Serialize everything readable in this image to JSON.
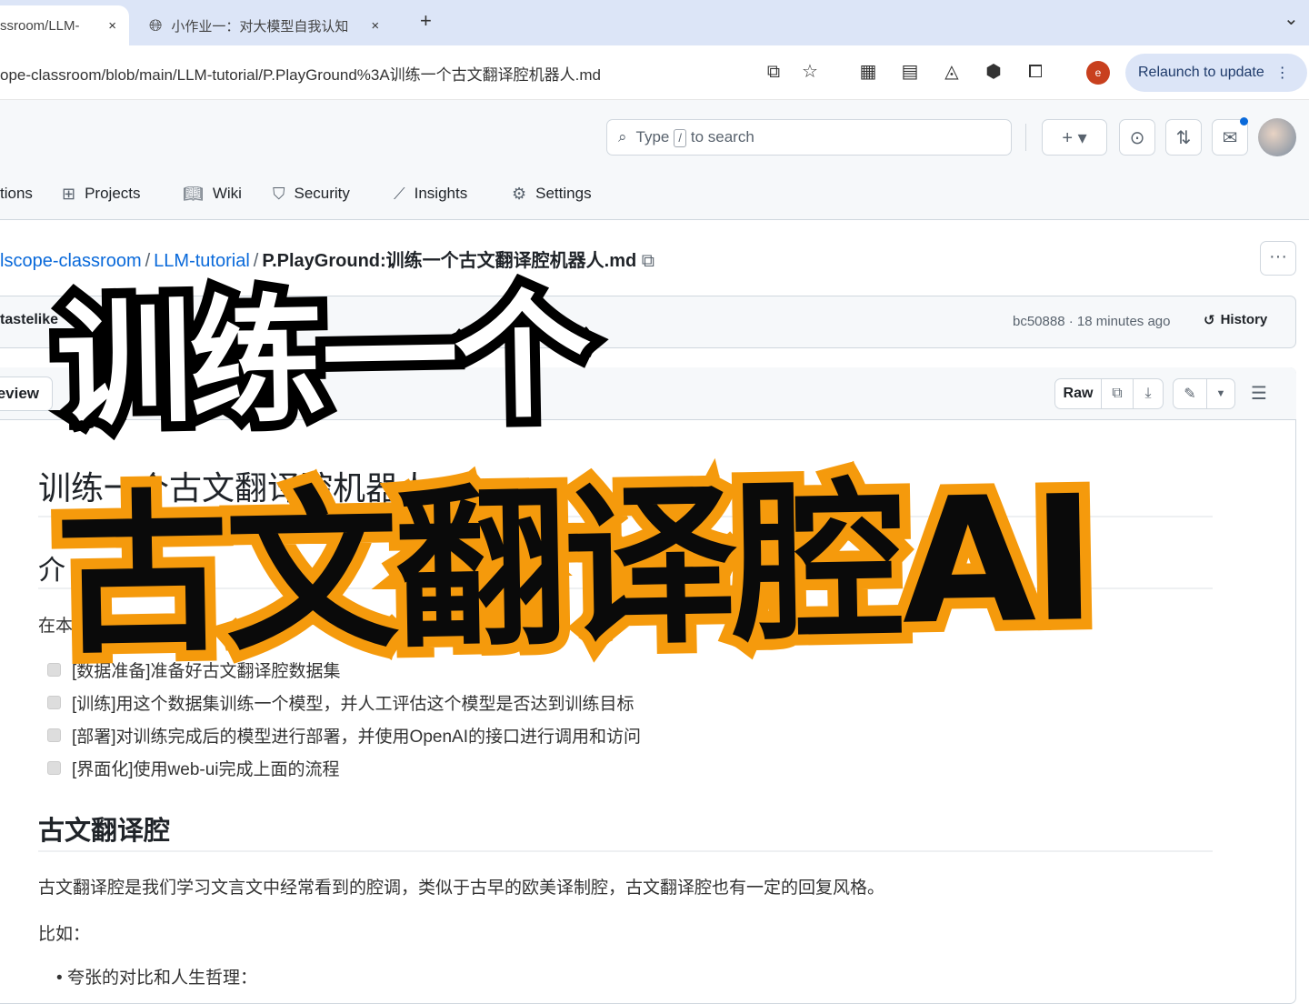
{
  "browser": {
    "tabs": [
      {
        "title": "ssroom/LLM-",
        "close": "×"
      },
      {
        "title": "小作业一：对大模型自我认知",
        "close": "×"
      }
    ],
    "new_tab": "+",
    "tab_menu": "⌄",
    "url": "ope-classroom/blob/main/LLM-tutorial/P.PlayGround%3A训练一个古文翻译腔机器人.md",
    "relaunch": "Relaunch to update",
    "profile_letter": "e"
  },
  "header": {
    "search_prefix": "Type",
    "search_key": "/",
    "search_suffix": "to search",
    "nav": [
      {
        "label": "tions",
        "icon": "play-icon"
      },
      {
        "label": "Projects",
        "icon": "table-icon"
      },
      {
        "label": "Wiki",
        "icon": "book-icon"
      },
      {
        "label": "Security",
        "icon": "shield-icon"
      },
      {
        "label": "Insights",
        "icon": "graph-icon"
      },
      {
        "label": "Settings",
        "icon": "gear-icon"
      }
    ]
  },
  "breadcrumb": {
    "owner": "lscope-classroom",
    "repo": "LLM-tutorial",
    "file": "P.PlayGround:训练一个古文翻译腔机器人.md",
    "sep": "/"
  },
  "commit": {
    "author": "tastelike",
    "hash": "bc50888",
    "time": "18 minutes ago",
    "history": "History"
  },
  "file": {
    "preview": "eview",
    "raw": "Raw"
  },
  "content": {
    "h1": "训练一个古文翻译腔机器人",
    "h2_intro": "介",
    "intro_fragment": "在本",
    "tasks": [
      "[数据准备]准备好古文翻译腔数据集",
      "[训练]用这个数据集训练一个模型，并人工评估这个模型是否达到训练目标",
      "[部署]对训练完成后的模型进行部署，并使用OpenAI的接口进行调用和访问",
      "[界面化]使用web-ui完成上面的流程"
    ],
    "h2": "古文翻译腔",
    "p1": "古文翻译腔是我们学习文言文中经常看到的腔调，类似于古早的欧美译制腔，古文翻译腔也有一定的回复风格。",
    "p2": "比如：",
    "bullet1": "夸张的对比和人生哲理："
  },
  "overlay": {
    "line1": "训练一个",
    "line2": "古文翻译腔AI",
    "line1_color": "#ffffff",
    "line2_color": "#0a0a0a",
    "line2_outline": "#f59a0c"
  }
}
